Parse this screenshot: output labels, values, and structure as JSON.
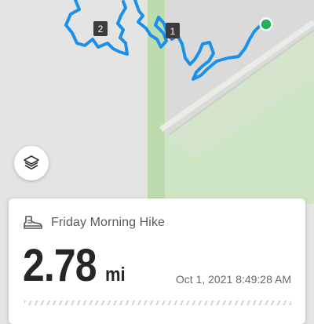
{
  "map": {
    "markers": [
      {
        "label": "2"
      },
      {
        "label": "1"
      }
    ],
    "route_color": "#1a90ea",
    "end_point_color": "#20b15a"
  },
  "layers_button": {
    "icon": "layers-icon"
  },
  "activity": {
    "icon": "hiking-boot-icon",
    "title": "Friday Morning Hike",
    "distance_value": "2.78",
    "distance_unit": "mi",
    "timestamp": "Oct 1, 2021 8:49:28 AM"
  }
}
